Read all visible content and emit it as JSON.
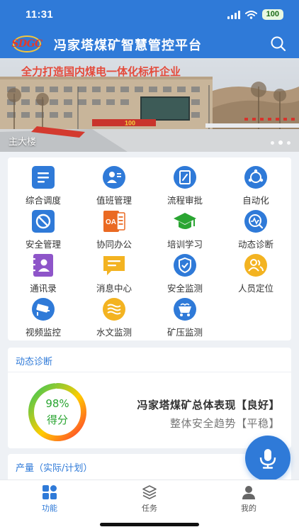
{
  "status_bar": {
    "time": "11:31",
    "battery": "100"
  },
  "header": {
    "logo_text": "SDGC",
    "title": "冯家塔煤矿智慧管控平台"
  },
  "banner": {
    "sign_text": "全力打造国内煤电一体化标杆企业",
    "board_text": "100",
    "caption": "主大楼",
    "slide_count": 3,
    "active_slide": 1
  },
  "grid": {
    "items": [
      {
        "label": "综合调度",
        "icon": "dispatch-icon",
        "color": "#2f7ad8"
      },
      {
        "label": "值班管理",
        "icon": "duty-icon",
        "color": "#2f7ad8"
      },
      {
        "label": "流程审批",
        "icon": "approval-icon",
        "color": "#2f7ad8"
      },
      {
        "label": "自动化",
        "icon": "automation-icon",
        "color": "#2f7ad8"
      },
      {
        "label": "安全管理",
        "icon": "safety-management-icon",
        "color": "#2f7ad8"
      },
      {
        "label": "协同办公",
        "icon": "office-icon",
        "color": "#ea6a23"
      },
      {
        "label": "培训学习",
        "icon": "graduation-cap-icon",
        "color": "#2aa532"
      },
      {
        "label": "动态诊断",
        "icon": "diagnosis-icon",
        "color": "#2f7ad8"
      },
      {
        "label": "通讯录",
        "icon": "contacts-icon",
        "color": "#8e55c9"
      },
      {
        "label": "消息中心",
        "icon": "message-icon",
        "color": "#f3b321"
      },
      {
        "label": "安全监测",
        "icon": "shield-icon",
        "color": "#2f7ad8"
      },
      {
        "label": "人员定位",
        "icon": "personnel-icon",
        "color": "#f3b321"
      },
      {
        "label": "视频监控",
        "icon": "camera-icon",
        "color": "#2f7ad8"
      },
      {
        "label": "水文监测",
        "icon": "water-icon",
        "color": "#f3b321"
      },
      {
        "label": "矿压监测",
        "icon": "mine-cart-icon",
        "color": "#2f7ad8"
      }
    ],
    "office_icon_text": "OA"
  },
  "diagnosis": {
    "title": "动态诊断",
    "score_text": "98%",
    "score_value": 98,
    "score_label": "得分",
    "summary": "冯家塔煤矿总体表现【良好】",
    "trend": "整体安全趋势【平稳】"
  },
  "production": {
    "title": "产量（实际/计划）"
  },
  "tabs": [
    {
      "label": "功能",
      "icon": "grid-icon",
      "active": true
    },
    {
      "label": "任务",
      "icon": "layers-icon",
      "active": false
    },
    {
      "label": "我的",
      "icon": "user-icon",
      "active": false
    }
  ],
  "colors": {
    "primary": "#2f7ad8",
    "score": "#2aa532"
  }
}
